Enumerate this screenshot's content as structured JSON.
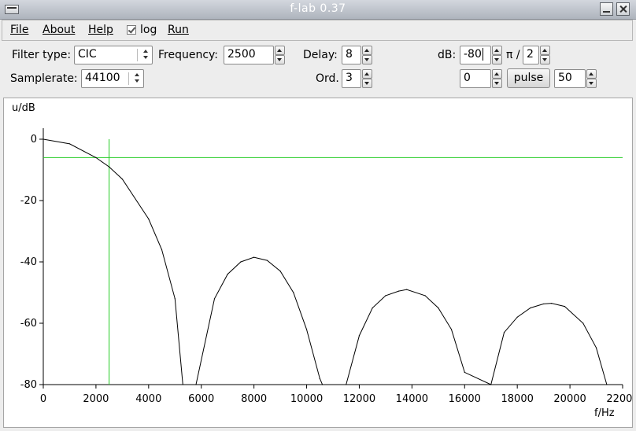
{
  "window": {
    "title": "f-lab 0.37"
  },
  "menu": {
    "file": "File",
    "about": "About",
    "help": "Help",
    "log_label": "log",
    "log_checked": true,
    "run": "Run"
  },
  "controls": {
    "filter_type_label": "Filter type:",
    "filter_type_value": "CIC",
    "frequency_label": "Frequency:",
    "frequency_value": "2500",
    "delay_label": "Delay:",
    "delay_value": "8",
    "db_label": "dB:",
    "db_value": "-80",
    "pi_label": "π /",
    "pi_divisor": "2",
    "samplerate_label": "Samplerate:",
    "samplerate_value": "44100",
    "order_label": "Ord.",
    "order_value": "3",
    "phase_value": "0",
    "pulse_button": "pulse",
    "pulse_value": "50"
  },
  "chart_data": {
    "type": "line",
    "xlabel": "f/Hz",
    "ylabel": "u/dB",
    "xlim": [
      0,
      22000
    ],
    "ylim": [
      -80,
      0
    ],
    "xticks": [
      0,
      2000,
      4000,
      6000,
      8000,
      10000,
      12000,
      14000,
      16000,
      18000,
      20000,
      22000
    ],
    "yticks": [
      0,
      -20,
      -40,
      -60,
      -80
    ],
    "xtick_labels": [
      "0",
      "2000",
      "4000",
      "6000",
      "8000",
      "10000",
      "12000",
      "14000",
      "16000",
      "18000",
      "20000",
      "22000"
    ],
    "ytick_labels": [
      "0",
      "-20",
      "-40",
      "-60",
      "-80"
    ],
    "grid": false,
    "series": [
      {
        "color": "#000000",
        "x": [
          0,
          1000,
          2000,
          2500,
          3000,
          4000,
          4500,
          5000,
          5300,
          5800,
          6500,
          7000,
          7500,
          8000,
          8500,
          9000,
          9500,
          10000,
          10500,
          10600,
          11500,
          12000,
          12500,
          13000,
          13500,
          13800,
          14500,
          15000,
          15500,
          16000,
          17000,
          17500,
          18000,
          18500,
          19000,
          19300,
          19800,
          20500,
          21000,
          21400
        ],
        "y": [
          0,
          -1.5,
          -6,
          -9,
          -13,
          -26,
          -36,
          -52,
          -80,
          -80,
          -52,
          -44,
          -40,
          -38.5,
          -39.5,
          -43,
          -50,
          -62,
          -78,
          -80,
          -80,
          -64,
          -55,
          -51,
          -49.5,
          -49,
          -51,
          -55,
          -62,
          -76,
          -80,
          -63,
          -58,
          -55,
          -53.7,
          -53.5,
          -54.5,
          -60,
          -68,
          -80
        ]
      }
    ],
    "markers": {
      "horizontal_y": -6,
      "vertical_x": 2500,
      "color": "#22cc22"
    }
  }
}
